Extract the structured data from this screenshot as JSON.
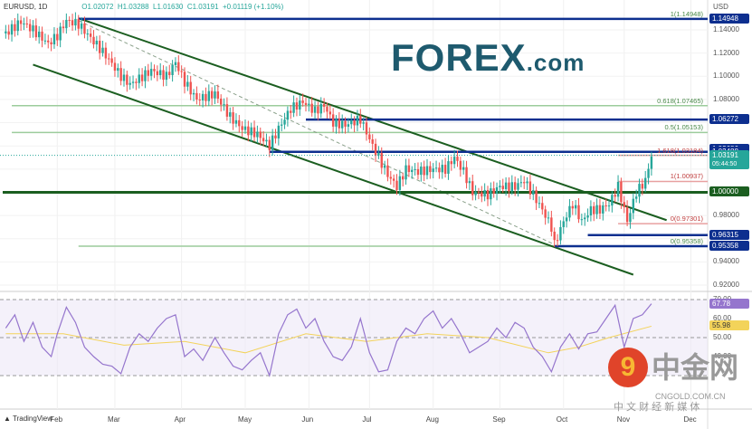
{
  "header": {
    "symbol": "EURUSD, 1D",
    "open": "O1.02072",
    "high": "H1.03288",
    "low": "L1.01630",
    "close": "C1.03191",
    "change": "+0.01119 (+1.10%)"
  },
  "logo": {
    "main": "FOREX",
    "suffix": ".com"
  },
  "watermark": {
    "cn": "中金网",
    "url": "CNGOLD.COM.CN",
    "sub": "中 文 财 经 新 媒 体"
  },
  "footer": {
    "brand": "TradingView"
  },
  "colors": {
    "up": "#26a69a",
    "down": "#ef5350",
    "blue": "#0d2f8f",
    "green": "#1b5e20",
    "fib_green": "#9ccc9c",
    "fib_red": "#e8a0a0",
    "rsi": "#9575cd",
    "rsi_ma": "#f3d35a"
  },
  "chart_data": {
    "type": "candlestick",
    "currency": "USD",
    "price_axis": [
      "1.14000",
      "1.12000",
      "1.10000",
      "1.08000",
      "0.98000",
      "0.94000",
      "0.92000"
    ],
    "price_range": [
      0.915,
      1.16
    ],
    "months": [
      "Feb",
      "Mar",
      "Apr",
      "May",
      "Jun",
      "Jul",
      "Aug",
      "Sep",
      "Oct",
      "Nov",
      "Dec"
    ],
    "month_day_index": [
      18,
      37,
      59,
      80,
      101,
      121,
      142,
      164,
      185,
      205,
      227
    ],
    "close_path": [
      [
        1,
        1.137
      ],
      [
        6,
        1.147
      ],
      [
        10,
        1.14
      ],
      [
        15,
        1.128
      ],
      [
        18,
        1.135
      ],
      [
        21,
        1.148
      ],
      [
        25,
        1.145
      ],
      [
        30,
        1.13
      ],
      [
        34,
        1.118
      ],
      [
        39,
        1.1
      ],
      [
        42,
        1.093
      ],
      [
        45,
        1.098
      ],
      [
        49,
        1.105
      ],
      [
        54,
        1.1
      ],
      [
        57,
        1.112
      ],
      [
        60,
        1.095
      ],
      [
        64,
        1.08
      ],
      [
        70,
        1.085
      ],
      [
        75,
        1.065
      ],
      [
        79,
        1.055
      ],
      [
        84,
        1.05
      ],
      [
        88,
        1.04
      ],
      [
        91,
        1.055
      ],
      [
        95,
        1.072
      ],
      [
        99,
        1.078
      ],
      [
        103,
        1.07
      ],
      [
        106,
        1.075
      ],
      [
        109,
        1.06
      ],
      [
        113,
        1.058
      ],
      [
        118,
        1.063
      ],
      [
        122,
        1.04
      ],
      [
        127,
        1.015
      ],
      [
        130,
        1.005
      ],
      [
        133,
        1.02
      ],
      [
        137,
        1.018
      ],
      [
        142,
        1.02
      ],
      [
        146,
        1.02
      ],
      [
        149,
        1.03
      ],
      [
        152,
        1.018
      ],
      [
        155,
        1.0
      ],
      [
        160,
        0.998
      ],
      [
        164,
        1.005
      ],
      [
        169,
        1.005
      ],
      [
        172,
        1.01
      ],
      [
        175,
        0.998
      ],
      [
        178,
        0.985
      ],
      [
        181,
        0.97
      ],
      [
        182,
        0.955
      ],
      [
        185,
        0.975
      ],
      [
        188,
        0.99
      ],
      [
        191,
        0.975
      ],
      [
        194,
        0.985
      ],
      [
        197,
        0.985
      ],
      [
        200,
        0.99
      ],
      [
        203,
        1.005
      ],
      [
        206,
        0.975
      ],
      [
        209,
        1.0
      ],
      [
        212,
        1.01
      ],
      [
        214,
        1.03191
      ]
    ],
    "horizontal_levels": [
      {
        "price": 1.14948,
        "label": "1.14948",
        "color": "blue",
        "from_day": 25
      },
      {
        "price": 1.06272,
        "label": "1.06272",
        "color": "blue",
        "from_day": 100
      },
      {
        "price": 1.03686,
        "label": "1.03686",
        "color": "blue",
        "from_day": 150,
        "hidden_line": true
      },
      {
        "price": 1.03488,
        "label": "1.03488",
        "color": "blue",
        "from_day": 88
      },
      {
        "price": 1.0,
        "label": "1.00000",
        "color": "green",
        "from_day": 0
      },
      {
        "price": 0.96315,
        "label": "0.96315",
        "color": "blue",
        "from_day": 193
      },
      {
        "price": 0.95358,
        "label": "0.95358",
        "color": "blue",
        "from_day": 182
      }
    ],
    "fib_levels": [
      {
        "price": 1.14948,
        "label": "1(1.14948)",
        "color": "fib_green",
        "from_day": 25
      },
      {
        "price": 1.07465,
        "label": "0.618(1.07465)",
        "color": "fib_green",
        "from_day": 3
      },
      {
        "price": 1.05153,
        "label": "0.5(1.05153)",
        "color": "fib_green",
        "from_day": 3
      },
      {
        "price": 0.95358,
        "label": "0(0.95358)",
        "color": "fib_green",
        "from_day": 25
      },
      {
        "price": 1.03184,
        "label": "1.618(1.03184)",
        "color": "fib_red",
        "from_day": 203
      },
      {
        "price": 1.00937,
        "label": "1(1.00937)",
        "color": "fib_red",
        "from_day": 203
      },
      {
        "price": 0.97301,
        "label": "0(0.97301)",
        "color": "fib_red",
        "from_day": 203
      }
    ],
    "last_price": {
      "value": "1.03191",
      "countdown": "05:44:50"
    },
    "trendlines": [
      {
        "from": [
          25,
          1.15
        ],
        "to": [
          219,
          0.976
        ],
        "style": "solid"
      },
      {
        "from": [
          10,
          1.11
        ],
        "to": [
          208,
          0.929
        ],
        "style": "solid"
      },
      {
        "from": [
          25,
          1.148
        ],
        "to": [
          182,
          0.955
        ],
        "style": "dashed"
      }
    ],
    "rsi": {
      "axis": [
        "70.00",
        "60.00",
        "50.00",
        "40.00"
      ],
      "value": "67.78",
      "ma_value": "55.98",
      "levels": [
        70,
        50,
        30
      ],
      "values": [
        [
          1,
          55
        ],
        [
          4,
          62
        ],
        [
          7,
          48
        ],
        [
          10,
          58
        ],
        [
          13,
          45
        ],
        [
          16,
          40
        ],
        [
          18,
          52
        ],
        [
          21,
          66
        ],
        [
          24,
          58
        ],
        [
          27,
          45
        ],
        [
          30,
          40
        ],
        [
          33,
          36
        ],
        [
          36,
          35
        ],
        [
          39,
          31
        ],
        [
          42,
          45
        ],
        [
          45,
          52
        ],
        [
          48,
          48
        ],
        [
          51,
          55
        ],
        [
          54,
          60
        ],
        [
          57,
          62
        ],
        [
          60,
          40
        ],
        [
          63,
          44
        ],
        [
          66,
          38
        ],
        [
          70,
          50
        ],
        [
          73,
          42
        ],
        [
          76,
          35
        ],
        [
          79,
          33
        ],
        [
          82,
          38
        ],
        [
          85,
          42
        ],
        [
          88,
          30
        ],
        [
          91,
          52
        ],
        [
          94,
          62
        ],
        [
          97,
          65
        ],
        [
          100,
          55
        ],
        [
          103,
          60
        ],
        [
          106,
          48
        ],
        [
          109,
          40
        ],
        [
          112,
          38
        ],
        [
          115,
          45
        ],
        [
          118,
          60
        ],
        [
          121,
          42
        ],
        [
          124,
          32
        ],
        [
          127,
          33
        ],
        [
          130,
          48
        ],
        [
          133,
          55
        ],
        [
          136,
          52
        ],
        [
          139,
          60
        ],
        [
          142,
          64
        ],
        [
          145,
          55
        ],
        [
          148,
          60
        ],
        [
          151,
          52
        ],
        [
          154,
          42
        ],
        [
          157,
          45
        ],
        [
          160,
          48
        ],
        [
          163,
          55
        ],
        [
          166,
          50
        ],
        [
          169,
          58
        ],
        [
          172,
          55
        ],
        [
          175,
          45
        ],
        [
          178,
          40
        ],
        [
          181,
          32
        ],
        [
          184,
          45
        ],
        [
          187,
          52
        ],
        [
          190,
          44
        ],
        [
          193,
          52
        ],
        [
          196,
          53
        ],
        [
          199,
          60
        ],
        [
          202,
          67
        ],
        [
          205,
          45
        ],
        [
          208,
          60
        ],
        [
          211,
          62
        ],
        [
          214,
          67.78
        ]
      ],
      "ma": [
        [
          1,
          52
        ],
        [
          20,
          52
        ],
        [
          40,
          46
        ],
        [
          60,
          48
        ],
        [
          80,
          42
        ],
        [
          100,
          52
        ],
        [
          120,
          48
        ],
        [
          140,
          52
        ],
        [
          160,
          50
        ],
        [
          180,
          42
        ],
        [
          190,
          45
        ],
        [
          200,
          50
        ],
        [
          214,
          55.98
        ]
      ]
    }
  }
}
